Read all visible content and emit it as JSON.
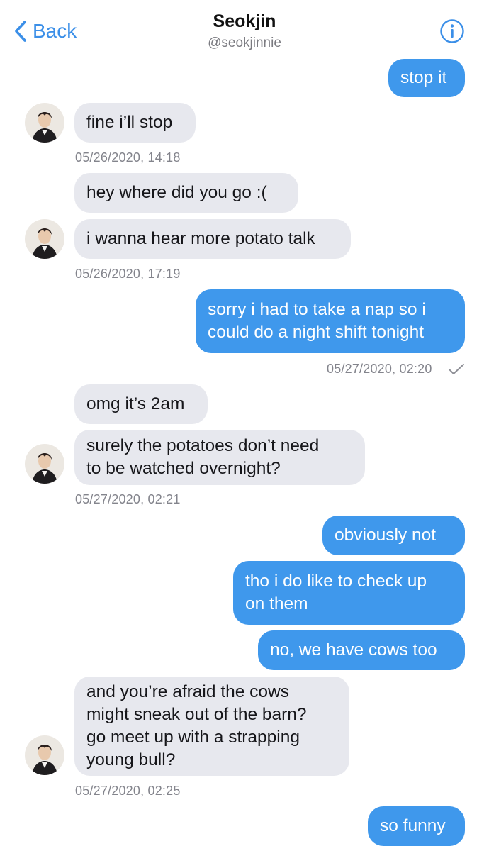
{
  "header": {
    "back_label": "Back",
    "title": "Seokjin",
    "handle": "@seokjinnie"
  },
  "messages": [
    {
      "text": "stop it",
      "direction": "out"
    },
    {
      "text": "fine i’ll stop",
      "direction": "in"
    },
    {
      "text": "hey where did you go :(",
      "direction": "in"
    },
    {
      "text": "i wanna hear more potato talk",
      "direction": "in"
    },
    {
      "lines": [
        "sorry i had to take a nap so i",
        "could do a night shift tonight"
      ],
      "direction": "out"
    },
    {
      "text": "omg it’s 2am",
      "direction": "in"
    },
    {
      "lines": [
        "surely the potatoes don’t need",
        "to be watched overnight?"
      ],
      "direction": "in"
    },
    {
      "text": "obviously not",
      "direction": "out"
    },
    {
      "lines": [
        "tho i do like to check up",
        "on them"
      ],
      "direction": "out"
    },
    {
      "text": "no, we have cows too",
      "direction": "out"
    },
    {
      "lines": [
        "and you’re afraid the cows",
        "might sneak out of the barn?",
        "go meet up with a strapping",
        "young bull?"
      ],
      "direction": "in"
    },
    {
      "text": "so funny",
      "direction": "out"
    }
  ],
  "timestamps": {
    "t1": "05/26/2020, 14:18",
    "t2": "05/26/2020, 17:19",
    "t3": "05/27/2020, 02:20",
    "t4": "05/27/2020, 02:21",
    "t5": "05/27/2020, 02:25"
  },
  "colors": {
    "accent": "#3b8fe8",
    "outgoing_bubble": "#3f98ec",
    "incoming_bubble": "#e7e8ee"
  }
}
